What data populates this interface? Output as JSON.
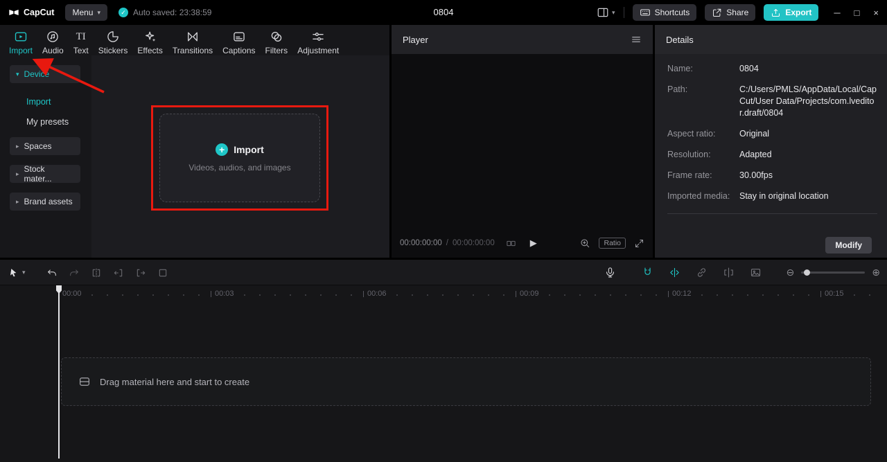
{
  "topbar": {
    "logo_text": "CapCut",
    "menu_label": "Menu",
    "autosave_text": "Auto saved: 23:38:59",
    "project_title": "0804",
    "shortcuts_label": "Shortcuts",
    "share_label": "Share",
    "export_label": "Export"
  },
  "media_panel": {
    "tabs": [
      {
        "label": "Import"
      },
      {
        "label": "Audio"
      },
      {
        "label": "Text"
      },
      {
        "label": "Stickers"
      },
      {
        "label": "Effects"
      },
      {
        "label": "Transitions"
      },
      {
        "label": "Captions"
      },
      {
        "label": "Filters"
      },
      {
        "label": "Adjustment"
      }
    ],
    "sidebar": [
      {
        "label": "Device"
      },
      {
        "label": "Import"
      },
      {
        "label": "My presets"
      },
      {
        "label": "Spaces"
      },
      {
        "label": "Stock mater..."
      },
      {
        "label": "Brand assets"
      }
    ],
    "dropzone": {
      "title": "Import",
      "subtitle": "Videos, audios, and images"
    }
  },
  "player": {
    "title": "Player",
    "current_time": "00:00:00:00",
    "separator": "/",
    "total_time": "00:00:00:00",
    "ratio_label": "Ratio"
  },
  "details": {
    "title": "Details",
    "rows": [
      {
        "label": "Name:",
        "value": "0804"
      },
      {
        "label": "Path:",
        "value": "C:/Users/PMLS/AppData/Local/CapCut/User Data/Projects/com.lveditor.draft/0804"
      },
      {
        "label": "Aspect ratio:",
        "value": "Original"
      },
      {
        "label": "Resolution:",
        "value": "Adapted"
      },
      {
        "label": "Frame rate:",
        "value": "30.00fps"
      },
      {
        "label": "Imported media:",
        "value": "Stay in original location"
      }
    ],
    "modify_label": "Modify"
  },
  "timeline": {
    "ruler": [
      "00:00",
      "00:03",
      "00:06",
      "00:09",
      "00:12",
      "00:15"
    ],
    "placeholder": "Drag material here and start to create"
  },
  "icons": {
    "plus": "+",
    "check": "✓",
    "caret_down": "▾",
    "caret_right": "▸",
    "play": "▶",
    "zoom_out": "⊖",
    "zoom_in": "⊕",
    "minimize": "─",
    "maximize": "□",
    "close": "×",
    "text_tab": "TI"
  },
  "colors": {
    "accent": "#1fc6c7",
    "annotation_red": "#e8190f",
    "export_bg": "#22c3c5"
  }
}
